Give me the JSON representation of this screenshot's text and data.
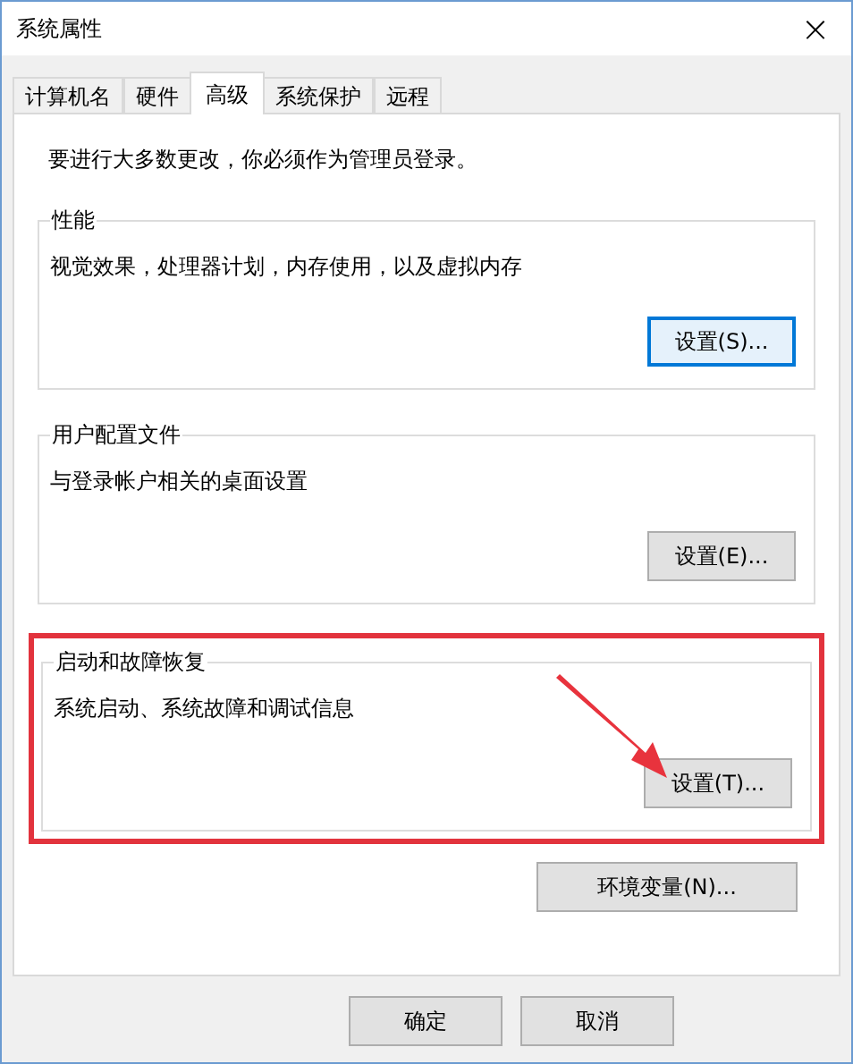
{
  "window": {
    "title": "系统属性",
    "close": "×"
  },
  "tabs": [
    {
      "label": "计算机名",
      "selected": false
    },
    {
      "label": "硬件",
      "selected": false
    },
    {
      "label": "高级",
      "selected": true
    },
    {
      "label": "系统保护",
      "selected": false
    },
    {
      "label": "远程",
      "selected": false
    }
  ],
  "notice": "要进行大多数更改，你必须作为管理员登录。",
  "groups": [
    {
      "title": "性能",
      "description": "视觉效果，处理器计划，内存使用，以及虚拟内存",
      "button": "设置(S)...",
      "focused": true,
      "highlighted": false
    },
    {
      "title": "用户配置文件",
      "description": "与登录帐户相关的桌面设置",
      "button": "设置(E)...",
      "focused": false,
      "highlighted": false
    },
    {
      "title": "启动和故障恢复",
      "description": "系统启动、系统故障和调试信息",
      "button": "设置(T)...",
      "focused": false,
      "highlighted": true
    }
  ],
  "env_button": "环境变量(N)...",
  "buttons": [
    "确定",
    "取消"
  ]
}
